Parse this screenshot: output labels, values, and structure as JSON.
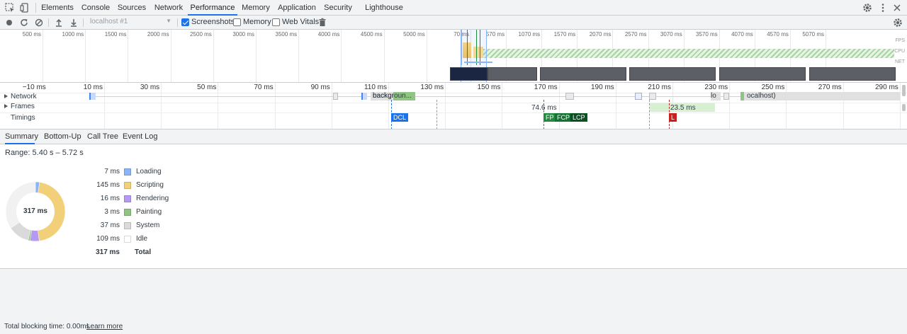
{
  "topbar": {
    "tabs": [
      "Elements",
      "Console",
      "Sources",
      "Network",
      "Performance",
      "Memory",
      "Application",
      "Security",
      "Lighthouse"
    ],
    "active_tab": "Performance"
  },
  "toolbar": {
    "profile_select": "localhost #1",
    "screenshots_label": "Screenshots",
    "screenshots_checked": true,
    "memory_label": "Memory",
    "memory_checked": false,
    "webvitals_label": "Web Vitals",
    "webvitals_checked": false
  },
  "overview": {
    "ticks_left": [
      "500 ms",
      "1000 ms",
      "1500 ms",
      "2000 ms",
      "2500 ms",
      "3000 ms",
      "3500 ms",
      "4000 ms",
      "4500 ms",
      "5000 ms"
    ],
    "ticks_right": [
      "70 ms",
      "570 ms",
      "1070 ms",
      "1570 ms",
      "2070 ms",
      "2570 ms",
      "3070 ms",
      "3570 ms",
      "4070 ms",
      "4570 ms",
      "5070 ms"
    ],
    "track_labels": [
      "FPS",
      "CPU",
      "NET"
    ]
  },
  "flamechart": {
    "ticks": [
      "−10 ms",
      "10 ms",
      "30 ms",
      "50 ms",
      "70 ms",
      "90 ms",
      "110 ms",
      "130 ms",
      "150 ms",
      "170 ms",
      "190 ms",
      "210 ms",
      "230 ms",
      "250 ms",
      "270 ms",
      "290 ms"
    ],
    "rows": [
      "Network",
      "Frames",
      "Timings"
    ],
    "network_items": [
      "backgroun...",
      "lo",
      "ocalhost)"
    ],
    "frames": [
      "74.6 ms",
      "23.5 ms"
    ],
    "markers": {
      "dcl": "DCL",
      "fp": "FP",
      "fcp": "FCP",
      "lcp": "LCP",
      "l": "L"
    }
  },
  "bottom_tabs": [
    "Summary",
    "Bottom-Up",
    "Call Tree",
    "Event Log"
  ],
  "summary": {
    "range": "Range: 5.40 s – 5.72 s",
    "total_center": "317 ms",
    "legend": [
      {
        "value": "7 ms",
        "name": "Loading",
        "color": "#8ab4f8"
      },
      {
        "value": "145 ms",
        "name": "Scripting",
        "color": "#f2d07a"
      },
      {
        "value": "16 ms",
        "name": "Rendering",
        "color": "#b69af2"
      },
      {
        "value": "3 ms",
        "name": "Painting",
        "color": "#8fc482"
      },
      {
        "value": "37 ms",
        "name": "System",
        "color": "#dadada"
      },
      {
        "value": "109 ms",
        "name": "Idle",
        "color": "#ffffff"
      }
    ],
    "total_value": "317 ms",
    "total_label": "Total",
    "chart_data": {
      "type": "pie",
      "categories": [
        "Loading",
        "Scripting",
        "Rendering",
        "Painting",
        "System",
        "Idle"
      ],
      "values": [
        7,
        145,
        16,
        3,
        37,
        109
      ]
    }
  },
  "footer": {
    "text": "Total blocking time: 0.00ms",
    "link": "Learn more"
  }
}
